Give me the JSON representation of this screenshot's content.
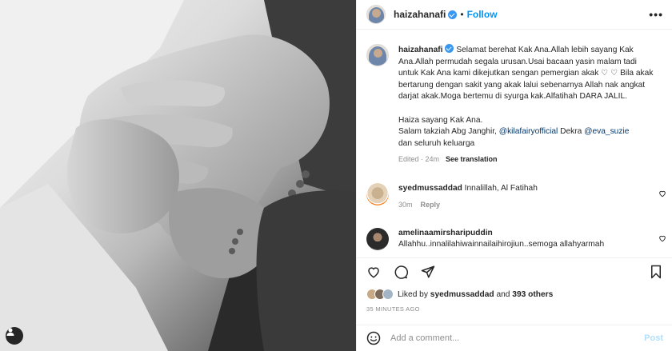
{
  "post": {
    "username": "haizahanafi",
    "follow_label": "Follow",
    "separator": "•",
    "more_label": "•••"
  },
  "caption": {
    "username": "haizahanafi",
    "line1": " Selamat berehat Kak Ana.Allah lebih sayang Kak Ana.Allah permudah segala urusan.Usai bacaan yasin malam tadi untuk Kak Ana kami dikejutkan sengan pemergian akak ♡ ♡ Bila akak bertarung dengan sakit yang akak lalui sebenarnya Allah nak angkat darjat akak.Moga bertemu di syurga kak.Alfatihah DARA JALIL.",
    "line2": "Haiza sayang Kak Ana.",
    "line3_prefix": "Salam takziah Abg Janghir, ",
    "mention1": "@kilafairyofficial",
    "line3_mid": " Dekra ",
    "mention2": "@eva_suzie",
    "line4": "dan seluruh keluarga",
    "edited": "Edited · 24m",
    "see_translation": "See translation"
  },
  "comments": [
    {
      "username": "syedmussaddad",
      "text": " Innalillah, Al Fatihah",
      "time": "30m",
      "reply_label": "Reply"
    },
    {
      "username": "amelinaamirsharipuddin",
      "text": "Allahhu..innalilahiwainnailaihirojiun..semoga allahyarmah"
    }
  ],
  "likes": {
    "prefix": "Liked by ",
    "user": "syedmussaddad",
    "middle": " and ",
    "others": "393 others"
  },
  "time_ago": "35 MINUTES AGO",
  "add_comment": {
    "placeholder": "Add a comment...",
    "post_label": "Post"
  },
  "colors": {
    "accent": "#0095f6",
    "verified": "#3897f0",
    "mention": "#00376b",
    "muted": "#8e8e8e"
  },
  "icons": [
    "user-tag-icon",
    "verified-icon",
    "more-icon",
    "heart-icon",
    "comment-icon",
    "share-icon",
    "bookmark-icon",
    "emoji-icon"
  ]
}
